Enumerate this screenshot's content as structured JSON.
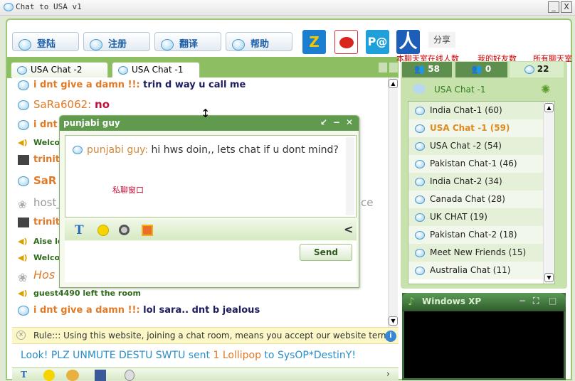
{
  "window": {
    "title": "Chat to USA v1",
    "minimize": "_",
    "close": "X"
  },
  "toolbar": {
    "buttons": [
      "登陆",
      "注册",
      "翻译",
      "帮助"
    ],
    "share_icons": [
      "qzone-icon",
      "weibo-icon",
      "tencent-weibo-icon",
      "renren-icon"
    ],
    "share_label": "分享",
    "renren_glyph": "人",
    "qzone_glyph": "Z"
  },
  "tabs": [
    "USA Chat -2",
    "USA Chat -1"
  ],
  "annotations": {
    "online_count": "本聊天室在线人数",
    "friends_count": "我的好友数",
    "all_rooms": "所有聊天室",
    "private_window": "私聊窗口"
  },
  "messages": [
    {
      "user": "i dnt give a damn !!:",
      "text": "trin d way u call me"
    },
    {
      "user": "SaRa6062:",
      "text": "no"
    },
    {
      "user": "i dnt",
      "text": ""
    },
    {
      "user": "",
      "text": "Welco"
    },
    {
      "user": "trinit",
      "text": ""
    },
    {
      "user": "SaR",
      "text": ""
    },
    {
      "user": "host_",
      "text": "ce"
    },
    {
      "user": "trinit",
      "text": ""
    },
    {
      "user": "",
      "text": "Aise le"
    },
    {
      "user": "",
      "text": "Welco"
    },
    {
      "user": "Hos",
      "text": ""
    },
    {
      "user": "",
      "text": "guest4490 left the room"
    },
    {
      "user": "i dnt give a damn !!:",
      "text": "lol sara.. dnt b jealous"
    }
  ],
  "rule": "Rule::: Using this website, joining a chat room, means you accept our website terms, click here to read",
  "announcement": {
    "pre": "Look! PLZ UNMUTE DESTU SWTU sent ",
    "gift": "1 Lollipop",
    "post": " to SysOP*DestinY!"
  },
  "popup": {
    "title": "punjabi guy",
    "message_user": "punjabi guy:",
    "message_text": "hi hws doin,, lets chat if u dont mind?",
    "send": "Send",
    "collapse": "<"
  },
  "stats": {
    "online": "58",
    "friends": "0",
    "rooms": "22"
  },
  "current_room": "USA Chat -1",
  "rooms": [
    {
      "name": "India Chat-1",
      "count": "(60)"
    },
    {
      "name": "USA Chat -1",
      "count": "(59)",
      "active": true
    },
    {
      "name": "USA Chat -2",
      "count": "(54)"
    },
    {
      "name": "Pakistan Chat-1",
      "count": "(46)"
    },
    {
      "name": "India Chat-2",
      "count": "(34)"
    },
    {
      "name": "Canada Chat",
      "count": "(28)"
    },
    {
      "name": "UK CHAT",
      "count": "(19)"
    },
    {
      "name": "Pakistan Chat-2",
      "count": "(18)"
    },
    {
      "name": "Meet New Friends",
      "count": "(15)"
    },
    {
      "name": "Australia Chat",
      "count": "(11)"
    }
  ],
  "media": {
    "title": "Windows XP"
  },
  "colors": {
    "green": "#8dbf62",
    "username": "#e07a26",
    "message": "#1c1c5e",
    "system": "#2f6b1a",
    "announce": "#2a8fc8"
  }
}
